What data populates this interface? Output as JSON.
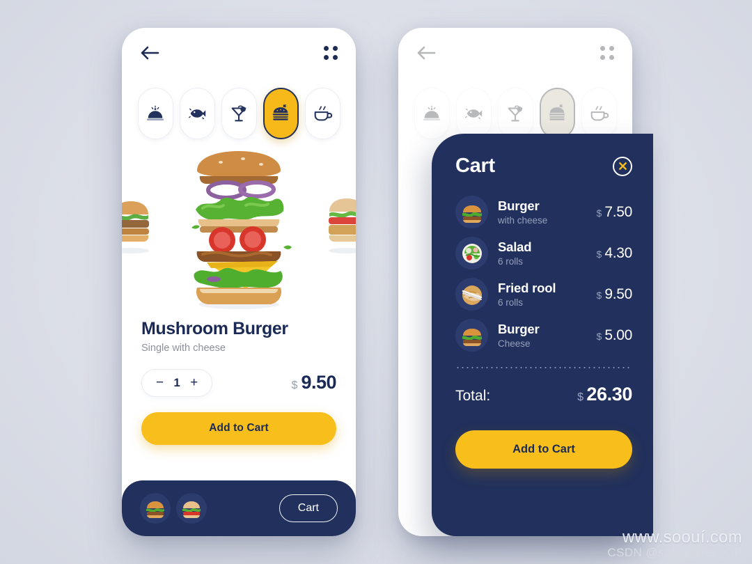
{
  "app": {
    "background_color": "#dcdfe8",
    "navy": "#21305c",
    "accent_yellow": "#f8bf1c"
  },
  "header": {
    "back_icon": "back-arrow-icon",
    "menu_icon": "grid-dots-icon"
  },
  "categories": [
    {
      "id": "dish",
      "icon": "cloche-dish-icon",
      "active": false
    },
    {
      "id": "fish",
      "icon": "fish-icon",
      "active": false
    },
    {
      "id": "drinks",
      "icon": "cocktail-glass-icon",
      "active": false
    },
    {
      "id": "burger",
      "icon": "burger-icon",
      "active": true
    },
    {
      "id": "coffee",
      "icon": "coffee-cup-icon",
      "active": false
    }
  ],
  "product": {
    "image": "exploded-burger-image",
    "title": "Mushroom Burger",
    "subtitle": "Single with cheese",
    "quantity": "1",
    "minus_label": "−",
    "plus_label": "+",
    "currency": "$",
    "price": "9.50",
    "add_to_cart_label": "Add to Cart"
  },
  "bottom_bar": {
    "thumbs": [
      {
        "icon": "burger-thumb-icon"
      },
      {
        "icon": "burger-thumb-icon"
      }
    ],
    "cart_label": "Cart"
  },
  "cart": {
    "title": "Cart",
    "close_icon": "close-x-icon",
    "items": [
      {
        "icon": "burger-thumb-icon",
        "name": "Burger",
        "desc": "with cheese",
        "currency": "$",
        "price": "7.50"
      },
      {
        "icon": "salad-thumb-icon",
        "name": "Salad",
        "desc": "6 rolls",
        "currency": "$",
        "price": "4.30"
      },
      {
        "icon": "friedroll-thumb-icon",
        "name": "Fried rool",
        "desc": "6 rolls",
        "currency": "$",
        "price": "9.50"
      },
      {
        "icon": "burger-thumb-icon",
        "name": "Burger",
        "desc": "Cheese",
        "currency": "$",
        "price": "5.00"
      }
    ],
    "total_label": "Total:",
    "total_currency": "$",
    "total_amount": "26.30",
    "add_to_cart_label": "Add to Cart"
  },
  "watermark": {
    "line1": "www.soouí.com",
    "line2": "CSDN @super_Dev_OP"
  }
}
